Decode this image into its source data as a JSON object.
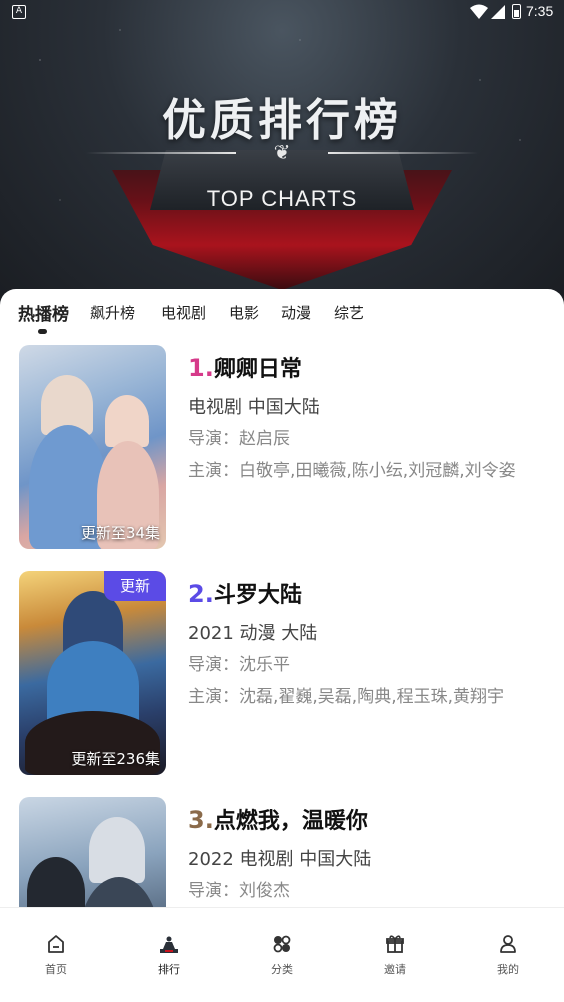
{
  "status_bar": {
    "time": "7:35",
    "notification_icon": "A"
  },
  "banner": {
    "title": "优质排行榜",
    "subtitle": "TOP CHARTS"
  },
  "tabs": [
    {
      "label": "热播榜",
      "active": true
    },
    {
      "label": "飙升榜"
    },
    {
      "label": "电视剧"
    },
    {
      "label": "电影"
    },
    {
      "label": "动漫"
    },
    {
      "label": "综艺"
    }
  ],
  "items": [
    {
      "rank": "1.",
      "rank_color": "#d63a8a",
      "title": "卿卿日常",
      "meta": " 电视剧  中国大陆",
      "director_label": "导演：",
      "director": "赵启辰",
      "cast_label": "主演：",
      "cast": "白敬亭,田曦薇,陈小纭,刘冠麟,刘令姿",
      "episodes": "更新至34集"
    },
    {
      "rank": "2.",
      "rank_color": "#5b4be6",
      "title": "斗罗大陆",
      "meta": "2021  动漫  大陆",
      "director_label": "导演：",
      "director": "沈乐平",
      "cast_label": "主演：",
      "cast": "沈磊,翟巍,吴磊,陶典,程玉珠,黄翔宇",
      "episodes": "更新至236集",
      "badge": "更新"
    },
    {
      "rank": "3.",
      "rank_color": "#8a6a4a",
      "title": "点燃我，温暖你",
      "meta": "2022  电视剧  中国大陆",
      "director_label": "导演：",
      "director": "刘俊杰"
    }
  ],
  "nav": [
    {
      "label": "首页",
      "icon": "home-icon"
    },
    {
      "label": "排行",
      "icon": "ranking-icon",
      "active": true
    },
    {
      "label": "分类",
      "icon": "category-icon"
    },
    {
      "label": "邀请",
      "icon": "gift-icon"
    },
    {
      "label": "我的",
      "icon": "user-icon"
    }
  ]
}
